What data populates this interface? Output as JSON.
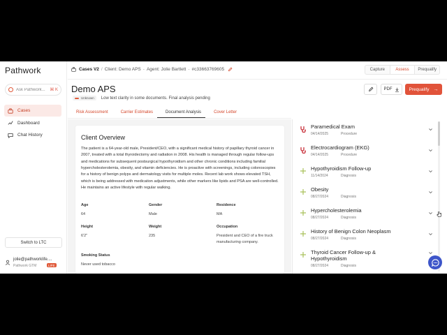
{
  "app": {
    "logo": "Pathwork",
    "search_placeholder": "Ask Pathwork...",
    "search_shortcut": "⌘ K",
    "nav": [
      {
        "label": "Cases",
        "icon": "briefcase-icon"
      },
      {
        "label": "Dashboard",
        "icon": "trend-icon"
      },
      {
        "label": "Chat History",
        "icon": "chat-icon"
      }
    ],
    "switch_label": "Switch to LTC",
    "user": {
      "email": "jolie@pathworklife....",
      "org": "Pathwork GTM",
      "badge": "LIFE"
    }
  },
  "header": {
    "breadcrumb": {
      "section": "Cases V2",
      "client": "Client: Demo APS",
      "agent": "Agent: Jolie Bartlett",
      "id": "#c33663769605"
    },
    "segments": [
      "Capture",
      "Assess",
      "Prequalify"
    ],
    "active_segment": "Assess",
    "title": "Demo APS",
    "status_badge": "Unknown",
    "status_note": "Low text clarity in some documents. Final analysis pending",
    "pdf_label": "PDF",
    "prequalify_label": "Prequalify"
  },
  "tabs": [
    "Risk Assessment",
    "Carrier Estimates",
    "Document Analysis",
    "Cover Letter"
  ],
  "active_tab": "Document Analysis",
  "overview": {
    "title": "Client Overview",
    "text": "The patient is a 64-year-old male, President/CEO, with a significant medical history of papillary thyroid cancer in 2007, treated with a total thyroidectomy and radiation in 2008. His health is managed through regular follow-ups and medications for subsequent postsurgical hypothyroidism and other chronic conditions including familial hypercholesterolemia, obesity, and vitamin deficiencies. He is proactive with screenings, including colonoscopies for a history of benign polyps and dermatology visits for multiple moles. Recent lab work shows elevated TSH, which is being addressed with medication adjustments, while other markers like lipids and PSA are well-controlled. He maintains an active lifestyle with regular walking.",
    "fields": {
      "age_label": "Age",
      "age": "64",
      "gender_label": "Gender",
      "gender": "Male",
      "residence_label": "Residence",
      "residence": "MA",
      "height_label": "Height",
      "height": "6'2\"",
      "weight_label": "Weight",
      "weight": "235",
      "occupation_label": "Occupation",
      "occupation": "President and CEO of a fire truck manufacturing company.",
      "smoking_label": "Smoking Status",
      "smoking": "Never used tobacco"
    }
  },
  "events": [
    {
      "title": "Paramedical Exam",
      "date": "04/14/2025",
      "kind": "Procedure",
      "icon": "stethoscope-icon"
    },
    {
      "title": "Electrocardiogram (EKG)",
      "date": "04/14/2025",
      "kind": "Procedure",
      "icon": "stethoscope-icon"
    },
    {
      "title": "Hypothyroidism Follow-up",
      "date": "11/14/2024",
      "kind": "Diagnosis",
      "icon": "plus-icon"
    },
    {
      "title": "Obesity",
      "date": "08/27/2024",
      "kind": "Diagnosis",
      "icon": "plus-icon"
    },
    {
      "title": "Hypercholesterolemia",
      "date": "08/27/2024",
      "kind": "Diagnosis",
      "icon": "plus-icon"
    },
    {
      "title": "History of Benign Colon Neoplasm",
      "date": "08/27/2024",
      "kind": "Diagnosis",
      "icon": "plus-icon"
    },
    {
      "title": "Thyroid Cancer Follow-up &",
      "title2": "Hypothyroidism",
      "date": "08/27/2024",
      "kind": "Diagnosis",
      "icon": "plus-icon"
    }
  ],
  "colors": {
    "accent": "#e1533a",
    "procedure_icon": "#c8303a",
    "diagnosis_icon": "#a9c15a",
    "chat_fab": "#3d55c9"
  }
}
